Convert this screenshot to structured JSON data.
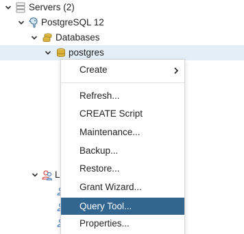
{
  "tree": {
    "servers": {
      "label": "Servers (2)",
      "icon": "servers-icon"
    },
    "server": {
      "label": "PostgreSQL 12",
      "icon": "postgresql-elephant-icon"
    },
    "databases": {
      "label": "Databases",
      "icon": "databases-icon"
    },
    "database": {
      "label": "postgres",
      "icon": "database-icon",
      "selected": true
    },
    "login_roles": {
      "label": "L",
      "icon": "login-roles-icon"
    },
    "role_icons": [
      "role-icon",
      "role-icon",
      "role-icon"
    ]
  },
  "context_menu": {
    "items": [
      {
        "label": "Create",
        "submenu": true
      },
      {
        "label": "Refresh..."
      },
      {
        "label": "CREATE Script"
      },
      {
        "label": "Maintenance..."
      },
      {
        "label": "Backup..."
      },
      {
        "label": "Restore..."
      },
      {
        "label": "Grant Wizard..."
      },
      {
        "label": "Query Tool...",
        "active": true
      },
      {
        "label": "Properties..."
      }
    ]
  },
  "colors": {
    "selection_bg": "#e4eef6",
    "menu_highlight": "#326690",
    "db_icon": "#c9a227",
    "server_icon": "#336791",
    "role_icon_red": "#d9534f",
    "role_icon_blue": "#4a7fc1"
  }
}
